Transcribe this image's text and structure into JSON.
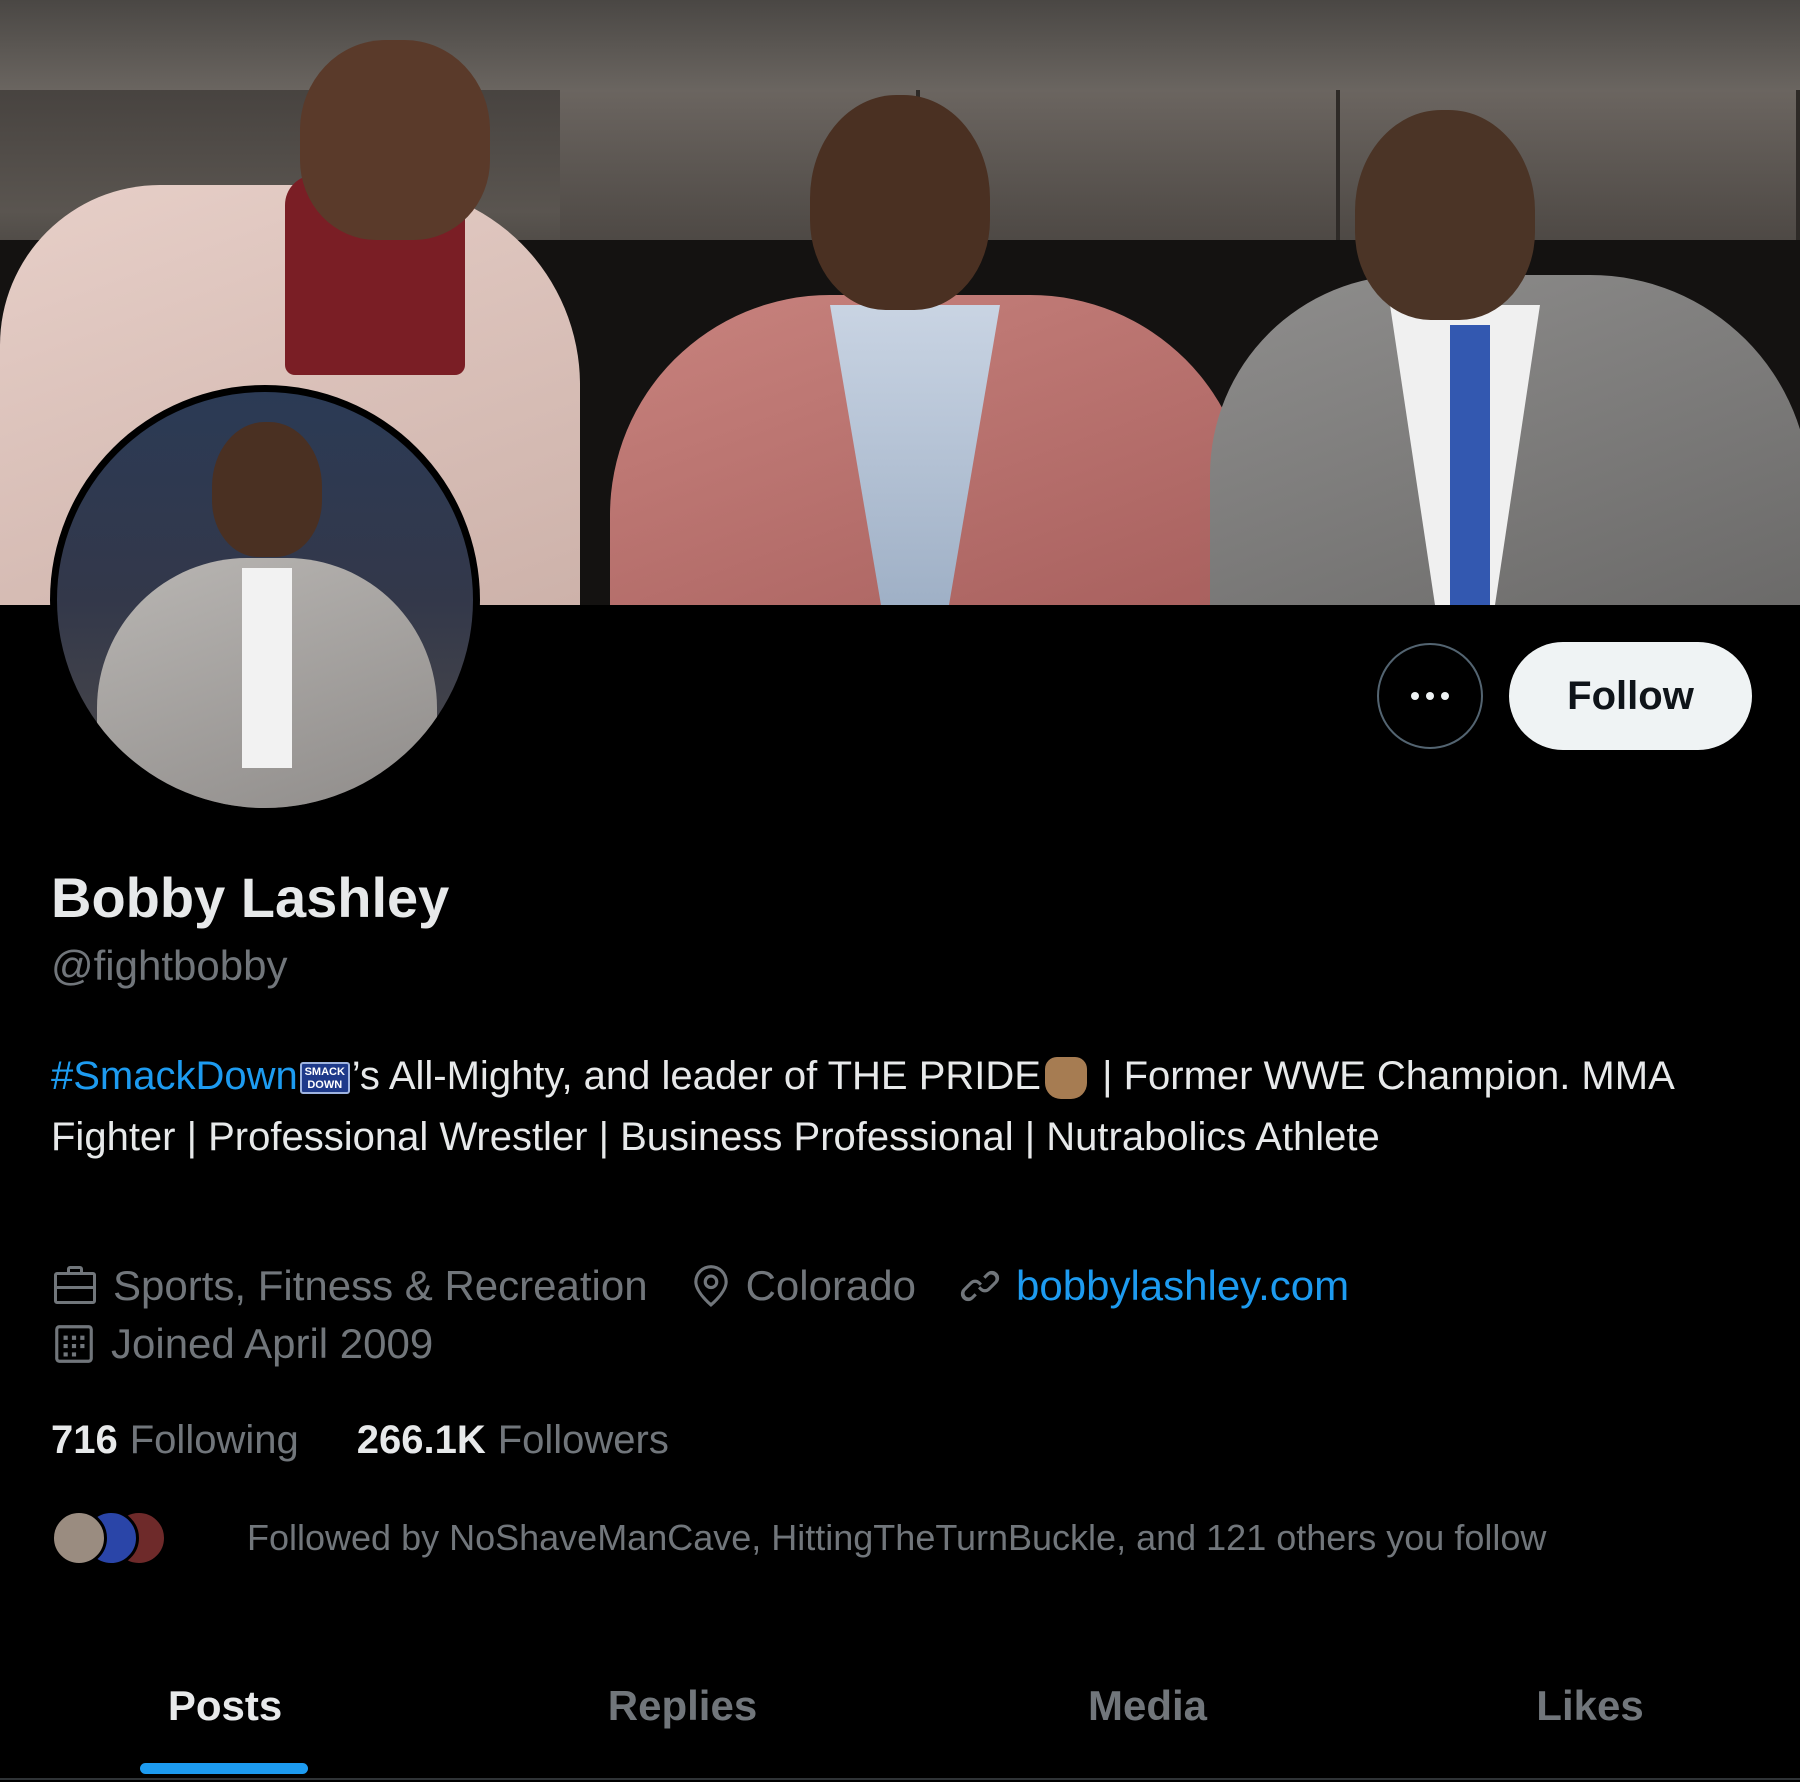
{
  "profile": {
    "name": "Bobby Lashley",
    "handle": "@fightbobby",
    "bio": {
      "hashtag": "#SmackDown",
      "badge_text": "SMACK DOWN",
      "part1": "’s All-Mighty, and leader of THE PRIDE",
      "part2": " | Former WWE Champion. MMA Fighter | Professional Wrestler | Business Professional | Nutrabolics Athlete"
    },
    "category": "Sports, Fitness & Recreation",
    "location": "Colorado",
    "website": "bobbylashley.com",
    "joined": "Joined April 2009",
    "following_count": "716",
    "following_label": "Following",
    "followers_count": "266.1K",
    "followers_label": "Followers",
    "followed_by": "Followed by NoShaveManCave, HittingTheTurnBuckle, and 121 others you follow"
  },
  "actions": {
    "follow_label": "Follow",
    "more_icon": "more-icon"
  },
  "tabs": [
    {
      "label": "Posts",
      "active": true
    },
    {
      "label": "Replies",
      "active": false
    },
    {
      "label": "Media",
      "active": false
    },
    {
      "label": "Likes",
      "active": false
    }
  ],
  "colors": {
    "accent": "#1d9bf0",
    "background": "#000000",
    "primary_text": "#e7e9ea",
    "secondary_text": "#71767b"
  }
}
